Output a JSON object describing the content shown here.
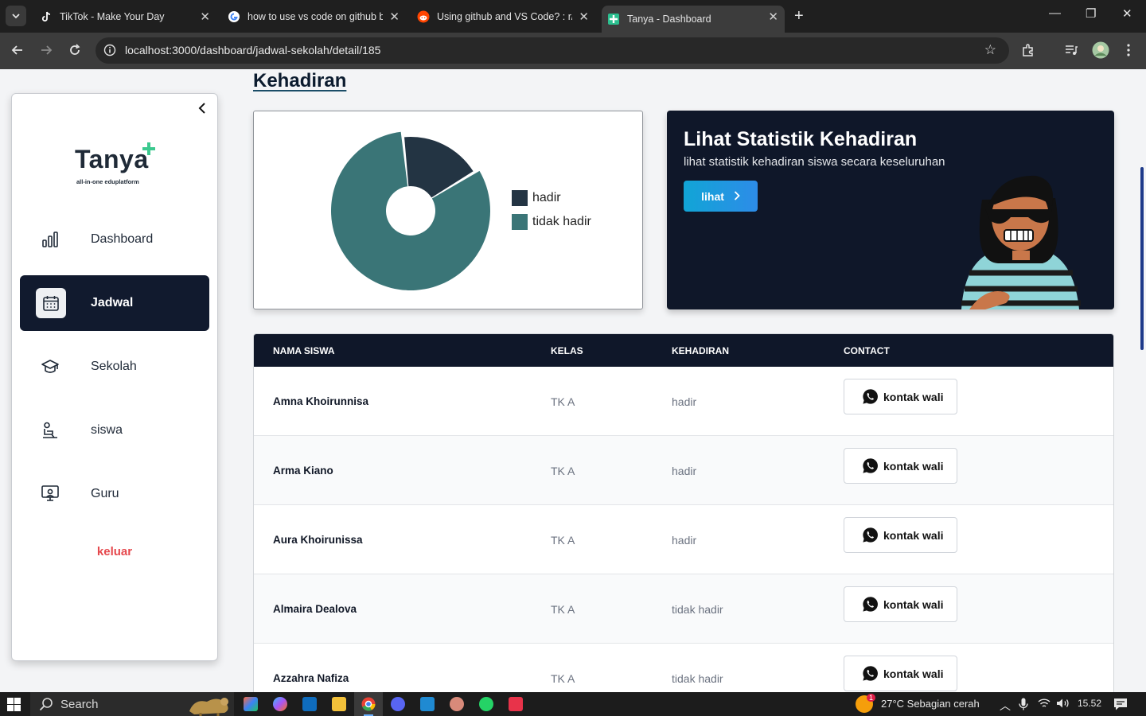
{
  "browser": {
    "tabs": [
      {
        "title": "TikTok - Make Your Day",
        "active": false
      },
      {
        "title": "how to use vs code on github b",
        "active": false
      },
      {
        "title": "Using github and VS Code? : r/",
        "active": false
      },
      {
        "title": "Tanya - Dashboard",
        "active": true
      }
    ],
    "url": "localhost:3000/dashboard/jadwal-sekolah/detail/185"
  },
  "sidebar": {
    "logo_text": "Tanya",
    "logo_tagline": "all-in-one eduplatform",
    "items": [
      {
        "label": "Dashboard",
        "icon": "bar-chart-icon",
        "active": false
      },
      {
        "label": "Jadwal",
        "icon": "calendar-icon",
        "active": true
      },
      {
        "label": "Sekolah",
        "icon": "graduation-cap-icon",
        "active": false
      },
      {
        "label": "siswa",
        "icon": "student-icon",
        "active": false
      },
      {
        "label": "Guru",
        "icon": "teacher-icon",
        "active": false
      }
    ],
    "logout_label": "keluar"
  },
  "main": {
    "title": "Kehadiran",
    "promo": {
      "title": "Lihat Statistik Kehadiran",
      "subtitle": "lihat statistik kehadiran siswa secara keseluruhan",
      "button_label": "lihat"
    },
    "table": {
      "headers": [
        "NAMA SISWA",
        "KELAS",
        "KEHADIRAN",
        "CONTACT"
      ],
      "contact_label": "kontak wali",
      "rows": [
        {
          "name": "Amna Khoirunnisa",
          "kelas": "TK A",
          "kehadiran": "hadir"
        },
        {
          "name": "Arma Kiano",
          "kelas": "TK A",
          "kehadiran": "hadir"
        },
        {
          "name": "Aura Khoirunissa",
          "kelas": "TK A",
          "kehadiran": "hadir"
        },
        {
          "name": "Almaira Dealova",
          "kelas": "TK A",
          "kehadiran": "tidak hadir"
        },
        {
          "name": "Azzahra Nafiza",
          "kelas": "TK A",
          "kehadiran": "tidak hadir"
        }
      ]
    }
  },
  "chart_data": {
    "type": "pie",
    "variant": "donut",
    "categories": [
      "hadir",
      "tidak hadir"
    ],
    "values": [
      18,
      82
    ],
    "colors": [
      "#233443",
      "#3a7577"
    ],
    "legend_position": "right"
  },
  "taskbar": {
    "search_label": "Search",
    "weather": "27°C  Sebagian cerah",
    "time": "15.52",
    "weather_badge": "1"
  }
}
